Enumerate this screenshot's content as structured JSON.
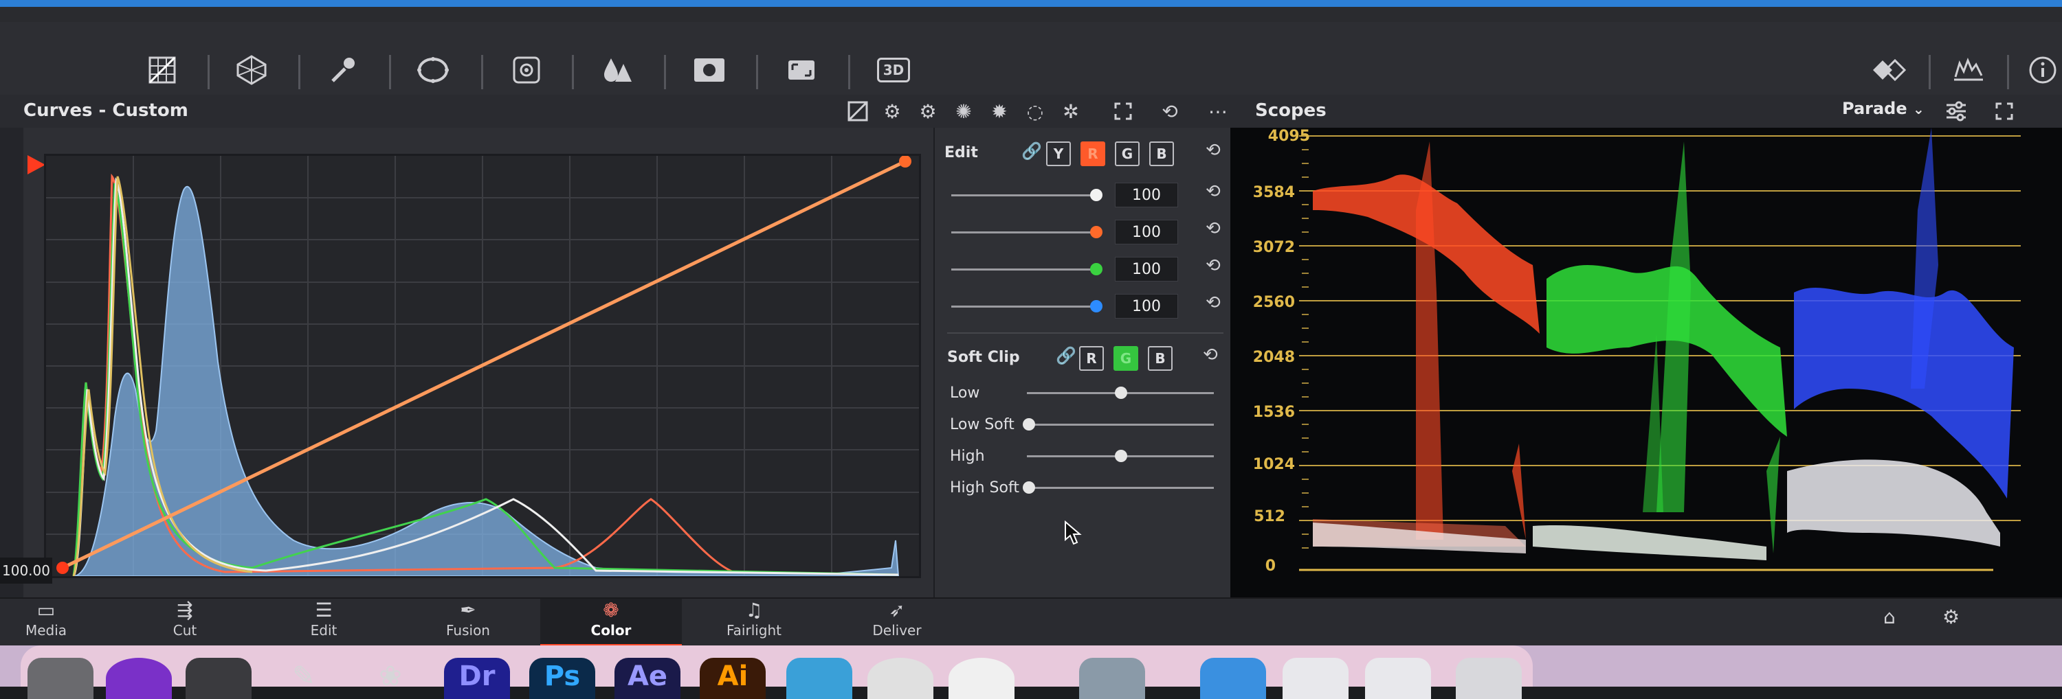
{
  "toolbar": {
    "tools": [
      {
        "icon": "curves-grid-icon"
      },
      {
        "icon": "color-warper-icon"
      },
      {
        "icon": "qualifier-eyedropper-icon"
      },
      {
        "icon": "window-icon"
      },
      {
        "icon": "tracker-icon"
      },
      {
        "icon": "blur-icon"
      },
      {
        "icon": "key-icon"
      },
      {
        "icon": "sizing-icon"
      },
      {
        "icon": "3d-icon",
        "label": "3D"
      }
    ],
    "right_tools": [
      {
        "icon": "split-screen-icon"
      },
      {
        "icon": "scopes-icon"
      },
      {
        "icon": "info-icon"
      }
    ]
  },
  "curves": {
    "title": "Curves - Custom",
    "value_readout": "100.00",
    "colors": {
      "curve": "#ff9a5c",
      "histogram": "#7fb2e6",
      "red": "#ff5a3a",
      "green": "#3cd048",
      "white": "#e8e8e8"
    }
  },
  "edit": {
    "label": "Edit",
    "channels": [
      "Y",
      "R",
      "G",
      "B"
    ],
    "active_channel": "R",
    "values": [
      "100",
      "100",
      "100",
      "100"
    ],
    "knob_colors": [
      "#f2f2f2",
      "#ff6a2a",
      "#3ad140",
      "#2d8cff"
    ]
  },
  "soft_clip": {
    "label": "Soft Clip",
    "channels": [
      "R",
      "G",
      "B"
    ],
    "active_channel": "G",
    "sliders": [
      {
        "label": "Low",
        "value": 0.36
      },
      {
        "label": "Low Soft",
        "value": 0.0
      },
      {
        "label": "High",
        "value": 0.5
      },
      {
        "label": "High Soft",
        "value": 0.0
      }
    ]
  },
  "scopes": {
    "title": "Scopes",
    "mode": "Parade",
    "y_ticks": [
      "4095",
      "3584",
      "3072",
      "2560",
      "2048",
      "1536",
      "1024",
      "512",
      "0"
    ],
    "grid_color": "#e0b94a"
  },
  "nav": {
    "items": [
      {
        "label": "Media",
        "icon": "media-icon"
      },
      {
        "label": "Cut",
        "icon": "cut-icon"
      },
      {
        "label": "Edit",
        "icon": "edit-icon"
      },
      {
        "label": "Fusion",
        "icon": "fusion-icon"
      },
      {
        "label": "Color",
        "icon": "color-icon"
      },
      {
        "label": "Fairlight",
        "icon": "fairlight-icon"
      },
      {
        "label": "Deliver",
        "icon": "deliver-icon"
      }
    ],
    "active": "Color"
  },
  "dock": {
    "apps": [
      {
        "label": "Dr",
        "color": "#1f1f8f",
        "text_color": "#8f8fff"
      },
      {
        "label": "Ps",
        "color": "#0b2a4a",
        "text_color": "#31a8ff"
      },
      {
        "label": "Ae",
        "color": "#1a1a4a",
        "text_color": "#9999ff"
      },
      {
        "label": "Ai",
        "color": "#3a1a08",
        "text_color": "#ff9a00"
      }
    ]
  }
}
